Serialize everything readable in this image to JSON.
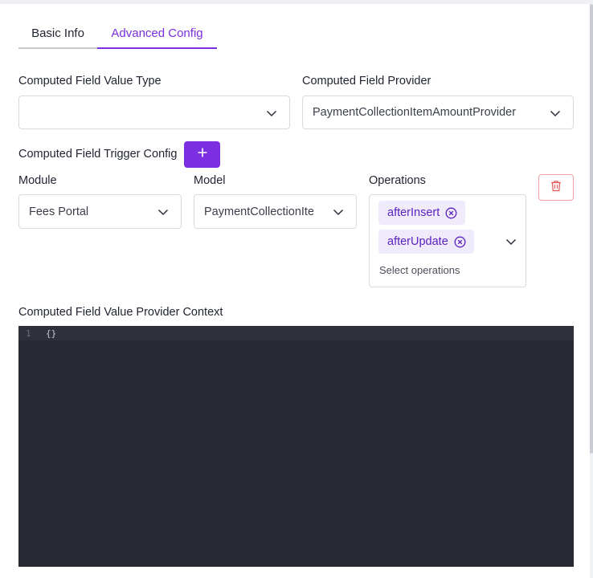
{
  "tabs": [
    {
      "label": "Basic Info",
      "active": false
    },
    {
      "label": "Advanced Config",
      "active": true
    }
  ],
  "fields": {
    "value_type": {
      "label": "Computed Field Value Type",
      "value": ""
    },
    "provider": {
      "label": "Computed Field Provider",
      "value": "PaymentCollectionItemAmountProvider"
    },
    "trigger_config": {
      "label": "Computed Field Trigger Config",
      "add_icon": "plus-icon"
    },
    "module": {
      "label": "Module",
      "value": "Fees Portal"
    },
    "model": {
      "label": "Model",
      "value": "PaymentCollectionItem"
    },
    "operations": {
      "label": "Operations",
      "selected": [
        "afterInsert",
        "afterUpdate"
      ],
      "placeholder": "Select operations"
    },
    "context": {
      "label": "Computed Field Value Provider Context",
      "line_number": "1",
      "code": "{}"
    }
  },
  "icons": {
    "delete": "trash-icon",
    "dropdown": "chevron-down-icon",
    "chip_remove": "circle-x-icon"
  },
  "colors": {
    "accent": "#7b2fe0",
    "danger": "#e25555",
    "editor_bg": "#272a33"
  }
}
